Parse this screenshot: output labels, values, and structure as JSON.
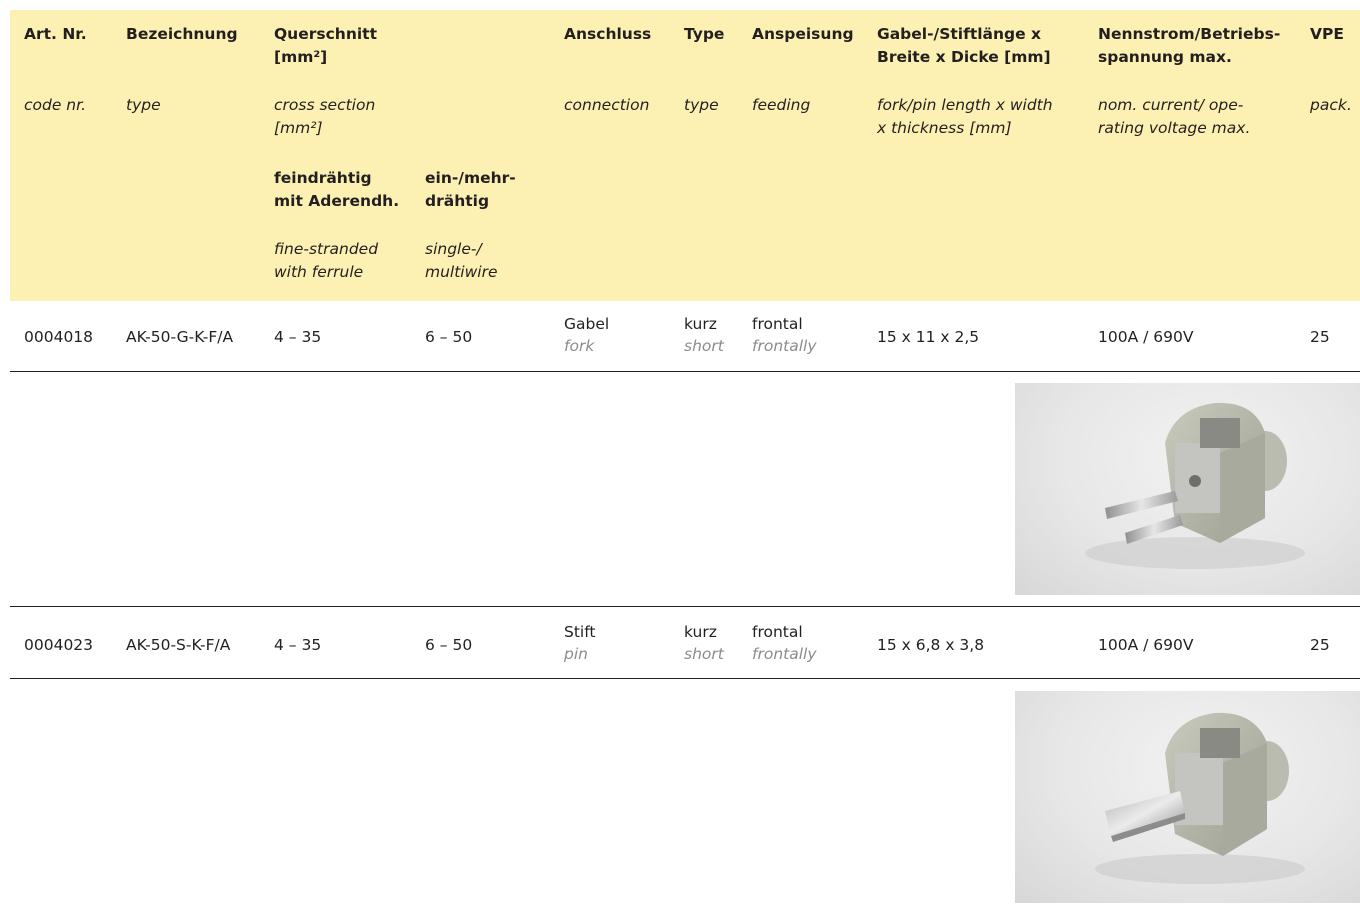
{
  "header": {
    "de": {
      "art_nr": "Art. Nr.",
      "bezeichnung": "Bezeichnung",
      "querschnitt_1": "Querschnitt",
      "querschnitt_2": "[mm²]",
      "anschluss": "Anschluss",
      "type": "Type",
      "anspeisung": "Anspeisung",
      "gabel_1": "Gabel-/Stiftlänge x",
      "gabel_2": "Breite x Dicke [mm]",
      "nenn_1": "Nennstrom/Betriebs-",
      "nenn_2": "spannung max.",
      "vpe": "VPE"
    },
    "en": {
      "code": "code nr.",
      "type": "type",
      "cross_1": "cross section",
      "cross_2": "[mm²]",
      "connection": "connection",
      "type2": "type",
      "feeding": "feeding",
      "fork_1": "fork/pin length x width",
      "fork_2": "x thickness [mm]",
      "nom_1": "nom. current/ ope-",
      "nom_2": "rating voltage max.",
      "pack": "pack."
    },
    "sub": {
      "fein_de_1": "feindrähtig",
      "fein_de_2": "mit Aderendh.",
      "ein_de_1": "ein-/mehr-",
      "ein_de_2": "drähtig",
      "fein_en_1": "fine-stranded",
      "fein_en_2": "with ferrule",
      "ein_en_1": "single-/",
      "ein_en_2": "multiwire"
    }
  },
  "rows": [
    {
      "art_nr": "0004018",
      "bezeichnung": "AK-50-G-K-F/A",
      "fein": "4 – 35",
      "ein": "6 – 50",
      "anschluss_de": "Gabel",
      "anschluss_en": "fork",
      "type_de": "kurz",
      "type_en": "short",
      "anspeisung_de": "frontal",
      "anspeisung_en": "frontally",
      "dims": "15 x 11 x 2,5",
      "nenn": "100A / 690V",
      "vpe": "25"
    },
    {
      "art_nr": "0004023",
      "bezeichnung": "AK-50-S-K-F/A",
      "fein": "4 – 35",
      "ein": "6 – 50",
      "anschluss_de": "Stift",
      "anschluss_en": "pin",
      "type_de": "kurz",
      "type_en": "short",
      "anspeisung_de": "frontal",
      "anspeisung_en": "frontally",
      "dims": "15 x 6,8 x 3,8",
      "nenn": "100A / 690V",
      "vpe": "25"
    }
  ],
  "colors": {
    "header_bg": "#fdf0b3",
    "text": "#231f20",
    "english_gray": "#8c8c8c",
    "rule": "#231f20"
  }
}
